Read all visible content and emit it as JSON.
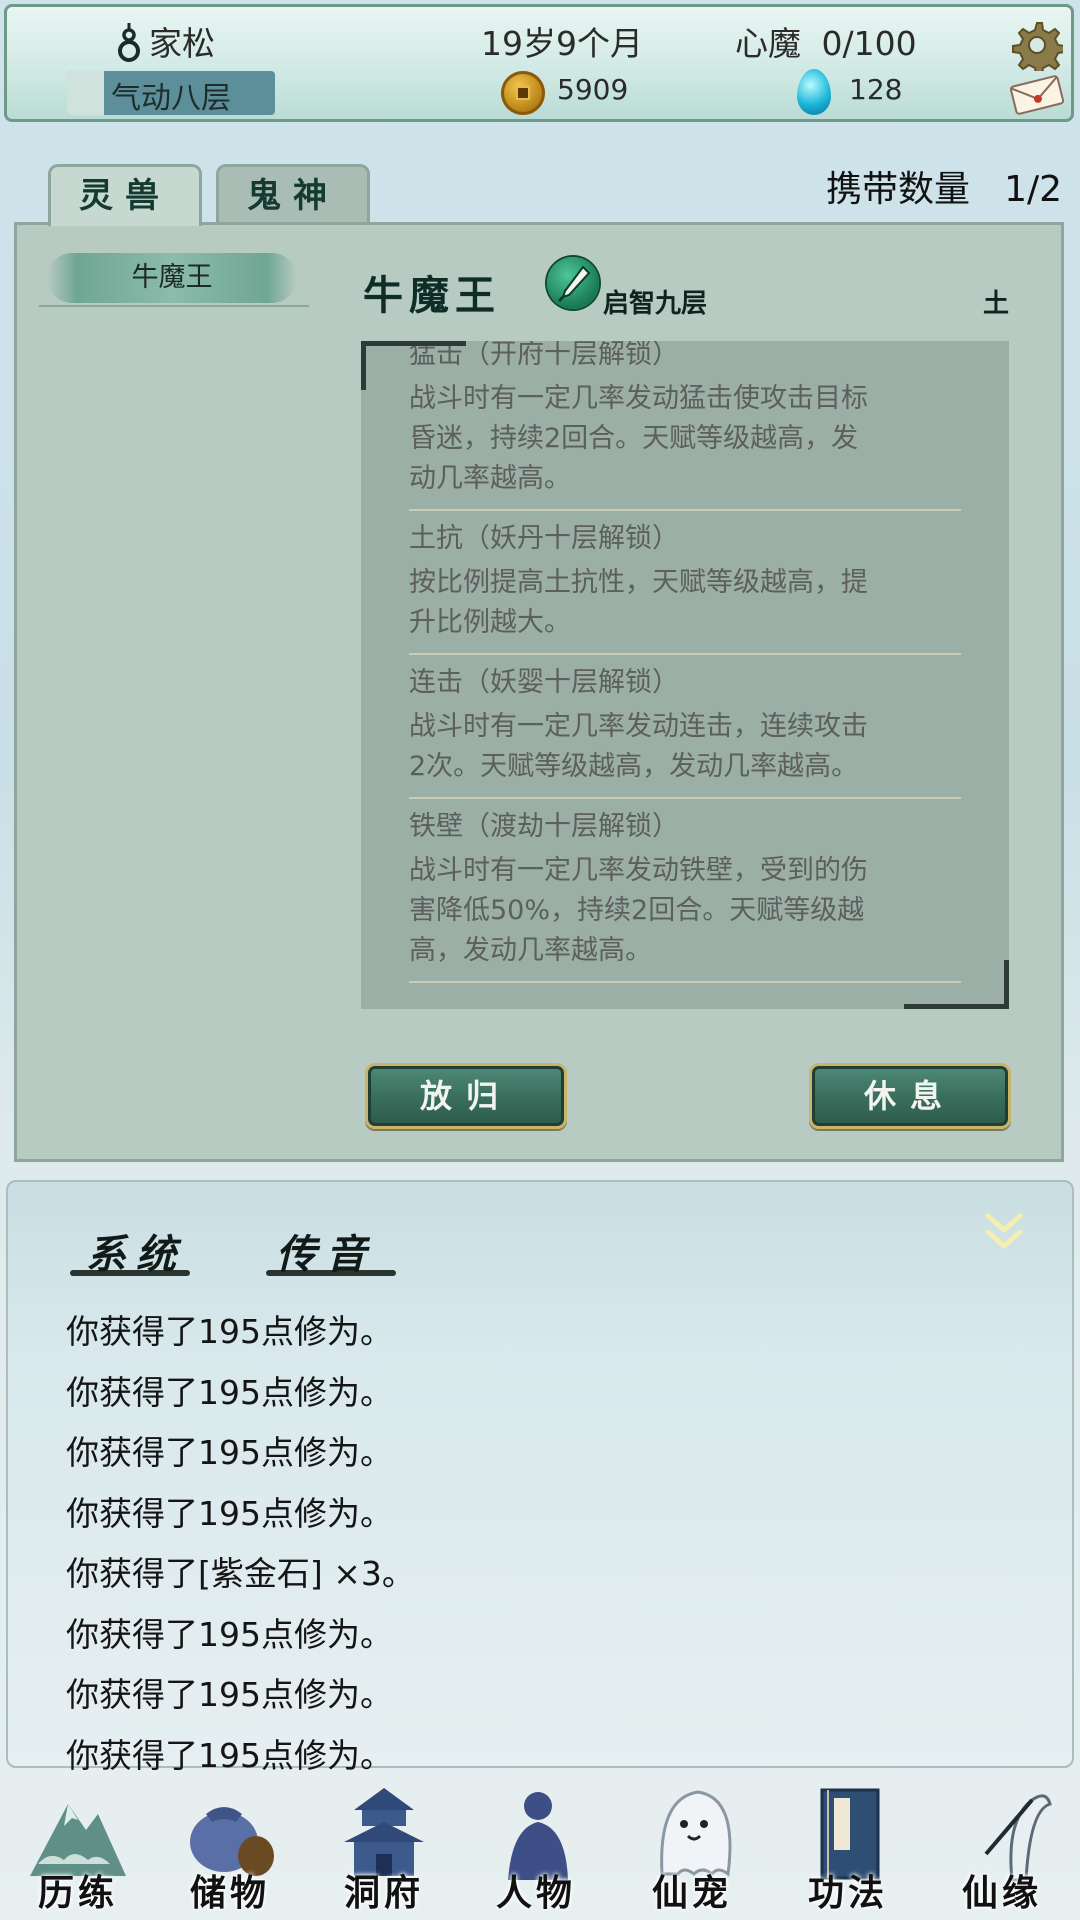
{
  "status": {
    "name": "家松",
    "age": "19岁9个月",
    "demon_label": "心魔",
    "demon_value": "0/100",
    "realm": "气动八层",
    "realm_progress": 0.18,
    "coins": "5909",
    "gems": "128"
  },
  "tabs": [
    "灵兽",
    "鬼神"
  ],
  "carry": {
    "label": "携带数量",
    "value": "1/2"
  },
  "pet_list": [
    "牛魔王"
  ],
  "pet": {
    "name": "牛魔王",
    "level": "启智九层",
    "element": "土",
    "skills": [
      {
        "title": "猛击（开府十层解锁）",
        "desc": "战斗时有一定几率发动猛击使攻击目标昏迷，持续2回合。天赋等级越高，发动几率越高。"
      },
      {
        "title": "土抗（妖丹十层解锁）",
        "desc": "按比例提高土抗性，天赋等级越高，提升比例越大。"
      },
      {
        "title": "连击（妖婴十层解锁）",
        "desc": "战斗时有一定几率发动连击，连续攻击2次。天赋等级越高，发动几率越高。"
      },
      {
        "title": "铁壁（渡劫十层解锁）",
        "desc": "战斗时有一定几率发动铁壁，受到的伤害降低50%，持续2回合。天赋等级越高，发动几率越高。"
      }
    ]
  },
  "buttons": {
    "release": "放归",
    "rest": "休息"
  },
  "chat": {
    "tabs": [
      "系统",
      "传音"
    ],
    "lines": [
      "你获得了195点修为。",
      "你获得了195点修为。",
      "你获得了195点修为。",
      "你获得了195点修为。",
      "你获得了[紫金石] ×3。",
      "你获得了195点修为。",
      "你获得了195点修为。",
      "你获得了195点修为。"
    ]
  },
  "nav": [
    "历练",
    "储物",
    "洞府",
    "人物",
    "仙宠",
    "功法",
    "仙缘"
  ],
  "icons": [
    "gourd-icon",
    "gear-icon",
    "mail-icon",
    "coin-icon",
    "spirit-gem-icon",
    "brush-icon",
    "collapse-chevron-icon"
  ]
}
